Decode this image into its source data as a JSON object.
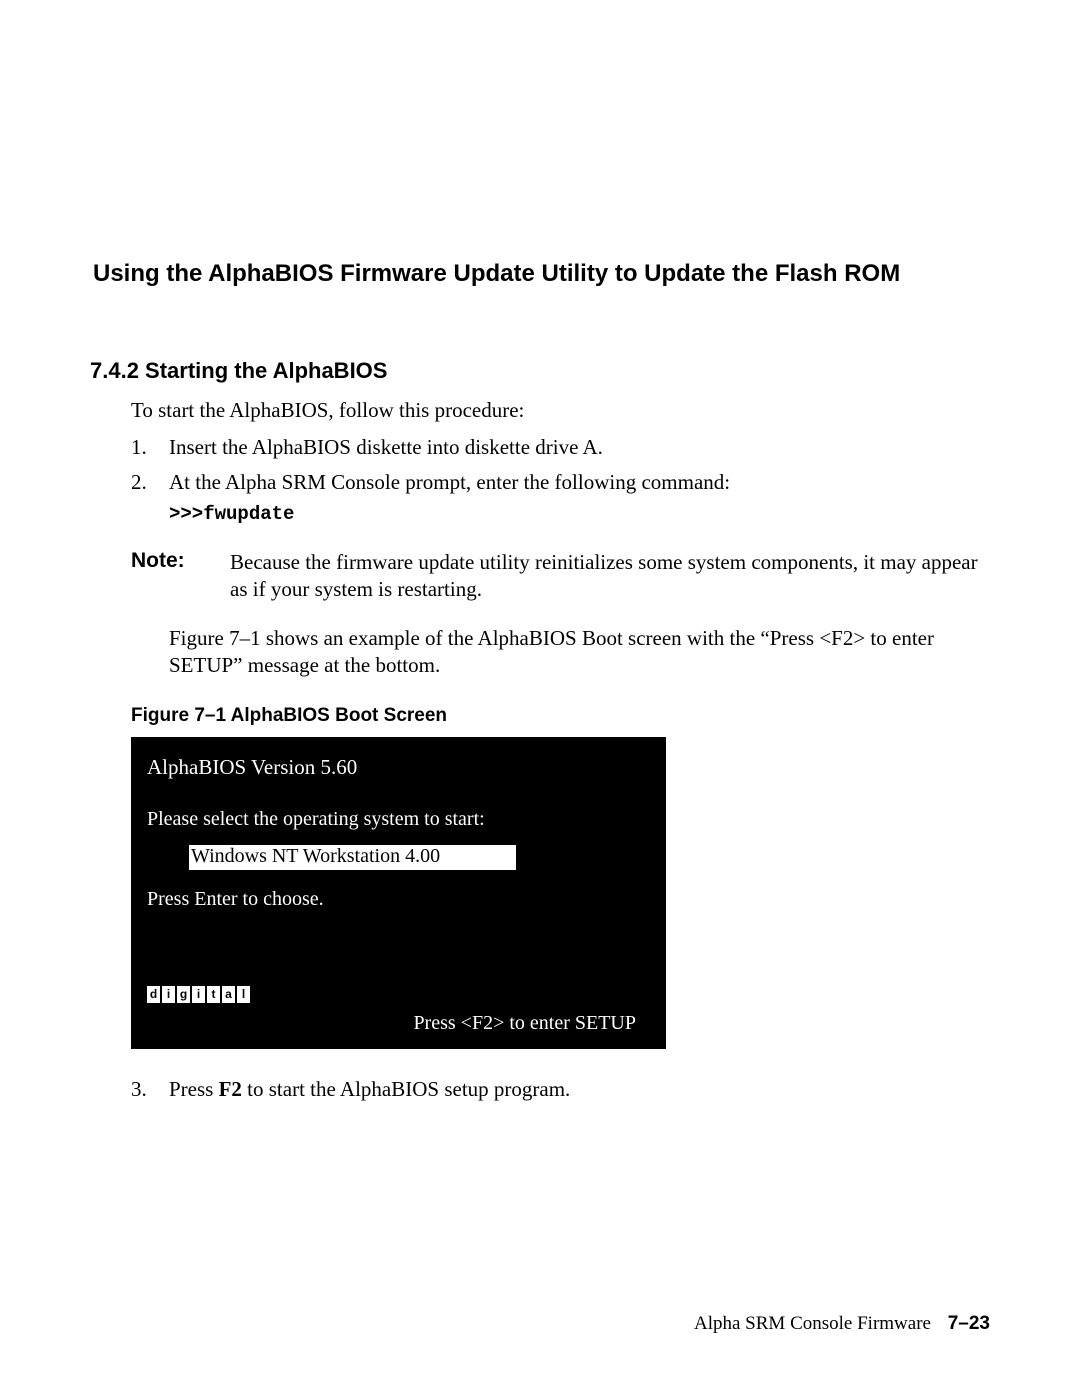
{
  "headings": {
    "main": "Using the AlphaBIOS Firmware Update Utility to Update the Flash ROM",
    "sub": "7.4.2  Starting the AlphaBIOS"
  },
  "intro": "To start the AlphaBIOS, follow this procedure:",
  "steps": {
    "s1_num": "1.",
    "s1": "Insert the AlphaBIOS diskette into diskette drive A.",
    "s2_num": "2.",
    "s2": "At the Alpha SRM Console prompt, enter the following command:",
    "code": ">>>fwupdate",
    "s3_num": "3.",
    "s3_pre": "Press ",
    "s3_bold": "F2",
    "s3_post": " to start the AlphaBIOS setup program."
  },
  "note": {
    "label": "Note:",
    "text": "Because the firmware update utility reinitializes some system components, it may appear as if your system is restarting."
  },
  "fig_ref": "Figure 7–1 shows an example of the AlphaBIOS Boot screen with the “Press <F2> to enter SETUP” message at the bottom.",
  "fig_caption": "Figure 7–1  AlphaBIOS Boot Screen",
  "boot": {
    "title": "AlphaBIOS Version 5.60",
    "prompt": "Please select the operating system to start:",
    "selected": "Windows NT Workstation 4.00",
    "enter": "Press Enter to choose.",
    "logo": [
      "d",
      "i",
      "g",
      "i",
      "t",
      "a",
      "l"
    ],
    "f2": "Press <F2> to enter SETUP"
  },
  "footer": {
    "label": "Alpha SRM Console Firmware",
    "page": "7–23"
  }
}
